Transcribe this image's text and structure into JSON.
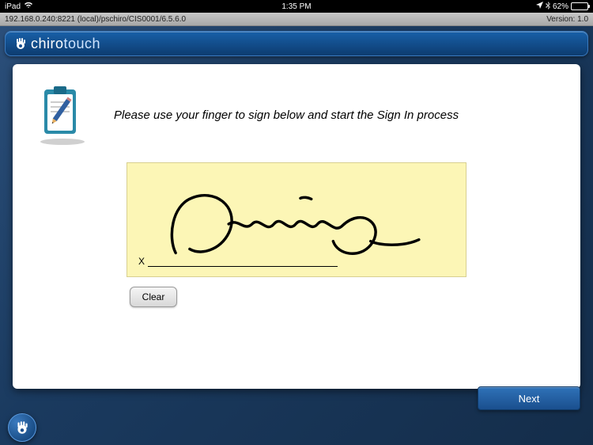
{
  "status": {
    "carrier": "iPad",
    "time": "1:35 PM",
    "battery_pct": "62%",
    "battery_level": 62
  },
  "info": {
    "server_path": "192.168.0.240:8221 (local)/pschiro/CIS0001/6.5.6.0",
    "version_label": "Version: 1.0"
  },
  "logo": {
    "part1": "chiro",
    "part2": "touch"
  },
  "content": {
    "instruction": "Please use your finger to sign below and start the Sign In process",
    "signature_marker": "X",
    "clear_label": "Clear",
    "next_label": "Next"
  },
  "icons": {
    "clipboard": "clipboard-pencil-icon",
    "hand": "hand-icon"
  }
}
